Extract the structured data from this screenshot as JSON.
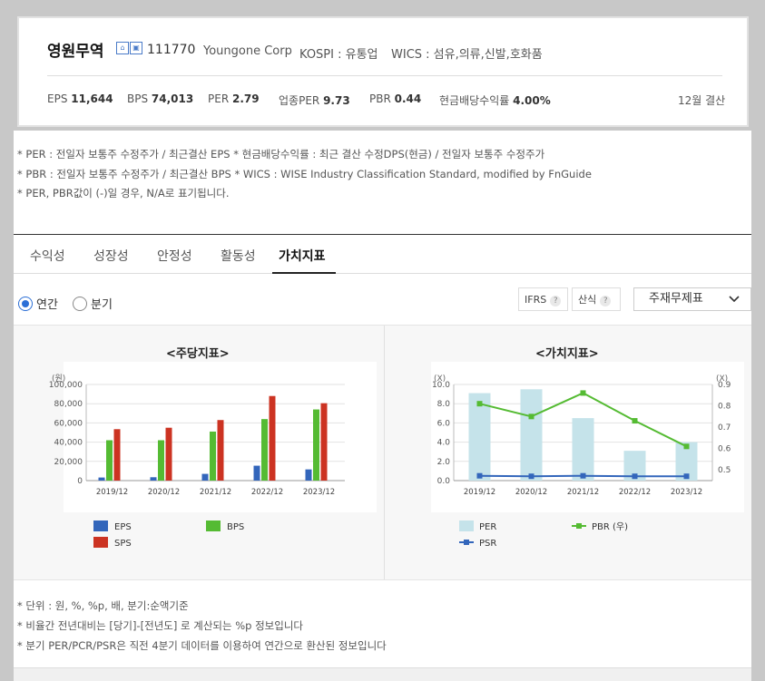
{
  "company": {
    "name": "영원무역",
    "code": "111770",
    "name_en": "Youngone Corp",
    "market": "KOSPI : 유통업",
    "wics": "WICS : 섬유,의류,신발,호화품",
    "settlement": "12월 결산"
  },
  "metrics": [
    {
      "label": "EPS",
      "value": "11,644"
    },
    {
      "label": "BPS",
      "value": "74,013"
    },
    {
      "label": "PER",
      "value": "2.79"
    },
    {
      "label": "업종PER",
      "value": "9.73"
    },
    {
      "label": "PBR",
      "value": "0.44"
    },
    {
      "label": "현금배당수익률",
      "value": "4.00%"
    }
  ],
  "notes": [
    "* PER : 전일자 보통주 수정주가 / 최근결산 EPS * 현금배당수익률 : 최근 결산 수정DPS(현금) / 전일자 보통주 수정주가",
    "* PBR : 전일자 보통주 수정주가 / 최근결산 BPS * WICS : WISE Industry Classification Standard, modified by FnGuide",
    "* PER, PBR값이 (-)일 경우, N/A로 표기됩니다."
  ],
  "tabs": [
    "수익성",
    "성장성",
    "안정성",
    "활동성",
    "가치지표"
  ],
  "period": {
    "annual": "연간",
    "quarter": "분기"
  },
  "options": {
    "ifrs": "IFRS",
    "calc": "산식",
    "qmark": "?",
    "select": "주재무제표"
  },
  "footnotes": [
    "* 단위 : 원, %, %p, 배, 분기:순액기준",
    "* 비율간 전년대비는 [당기]-[전년도] 로 계산되는 %p 정보입니다",
    "* 분기 PER/PCR/PSR은 직전 4분기 데이터를 이용하여 연간으로 환산된 정보입니다"
  ],
  "chart_data": [
    {
      "type": "bar",
      "title": "<주당지표>",
      "unit": "(원)",
      "categories": [
        "2019/12",
        "2020/12",
        "2021/12",
        "2022/12",
        "2023/12"
      ],
      "ylim": [
        0,
        100000
      ],
      "yticks": [
        "0",
        "20,000",
        "40,000",
        "60,000",
        "80,000",
        "100,000"
      ],
      "ytick_values": [
        0,
        20000,
        40000,
        60000,
        80000,
        100000
      ],
      "series": [
        {
          "name": "EPS",
          "color": "#3366bb",
          "values": [
            3200,
            3500,
            7000,
            15500,
            11644
          ]
        },
        {
          "name": "BPS",
          "color": "#55bb33",
          "values": [
            42000,
            42000,
            51000,
            64000,
            74013
          ]
        },
        {
          "name": "SPS",
          "color": "#cc3322",
          "values": [
            53500,
            55000,
            63000,
            88000,
            80500
          ]
        }
      ]
    },
    {
      "type": "bar+line",
      "title": "<가치지표>",
      "unit_left": "(X)",
      "unit_right": "(X)",
      "categories": [
        "2019/12",
        "2020/12",
        "2021/12",
        "2022/12",
        "2023/12"
      ],
      "ylim": [
        0,
        10
      ],
      "yticks": [
        "0.0",
        "2.0",
        "4.0",
        "6.0",
        "8.0",
        "10.0"
      ],
      "ytick_values": [
        0,
        2,
        4,
        6,
        8,
        10
      ],
      "y2lim": [
        0.45,
        0.9
      ],
      "y2ticks": [
        "0.5",
        "0.6",
        "0.7",
        "0.8",
        "0.9"
      ],
      "y2tick_values": [
        0.5,
        0.6,
        0.7,
        0.8,
        0.9
      ],
      "series": [
        {
          "name": "PER",
          "kind": "bar",
          "color": "#c5e3ea",
          "values": [
            9.1,
            9.5,
            6.5,
            3.1,
            4.0
          ]
        },
        {
          "name": "PBR (우)",
          "kind": "line",
          "axis": "right",
          "color": "#55bb33",
          "values": [
            0.81,
            0.75,
            0.86,
            0.73,
            0.61
          ]
        },
        {
          "name": "PSR",
          "kind": "line",
          "color": "#3366bb",
          "values": [
            0.5,
            0.45,
            0.5,
            0.45,
            0.45
          ]
        }
      ]
    }
  ]
}
